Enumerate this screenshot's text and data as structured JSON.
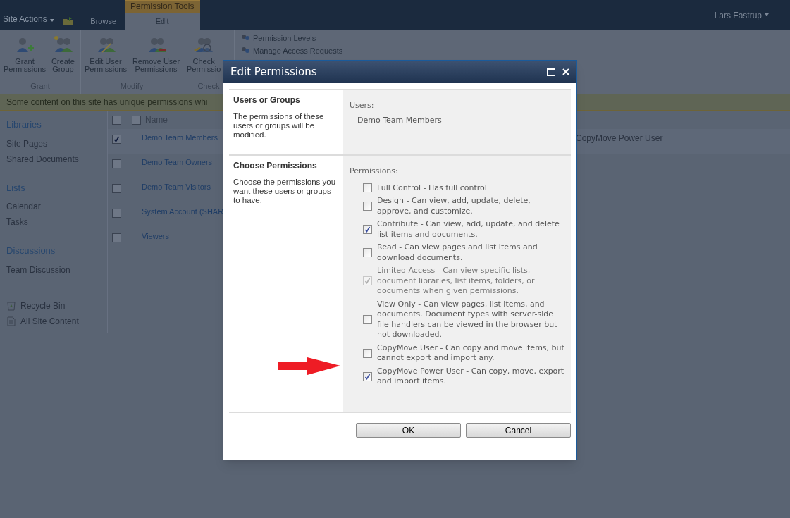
{
  "top_bar": {
    "site_actions": "Site Actions",
    "contextual_group": "Permission Tools",
    "tabs": [
      {
        "label": "Browse",
        "selected": false
      },
      {
        "label": "Edit",
        "selected": true
      }
    ],
    "user": "Lars Fastrup"
  },
  "ribbon": {
    "groups": [
      {
        "label": "Grant",
        "buttons": [
          {
            "kind": "grant",
            "lines": [
              "Grant",
              "Permissions"
            ]
          },
          {
            "kind": "create",
            "lines": [
              "Create",
              "Group"
            ]
          }
        ]
      },
      {
        "label": "Modify",
        "buttons": [
          {
            "kind": "edit",
            "lines": [
              "Edit User",
              "Permissions"
            ]
          },
          {
            "kind": "remove",
            "lines": [
              "Remove User",
              "Permissions"
            ]
          }
        ]
      },
      {
        "label": "Check",
        "buttons": [
          {
            "kind": "check",
            "lines": [
              "Check",
              "Permissio"
            ]
          }
        ]
      }
    ],
    "links": [
      "Permission Levels",
      "Manage Access Requests"
    ]
  },
  "notice": "Some content on this site has unique permissions whi",
  "sidebar": {
    "sections": [
      {
        "heading": "Libraries",
        "items": [
          "Site Pages",
          "Shared Documents"
        ]
      },
      {
        "heading": "Lists",
        "items": [
          "Calendar",
          "Tasks"
        ]
      },
      {
        "heading": "Discussions",
        "items": [
          "Team Discussion"
        ]
      }
    ],
    "footer_links": [
      {
        "kind": "recycle",
        "label": "Recycle Bin"
      },
      {
        "kind": "content",
        "label": "All Site Content"
      }
    ]
  },
  "table": {
    "select_all": {
      "checked": false
    },
    "columns": [
      {
        "label": "Name",
        "checked": false
      }
    ],
    "rows": [
      {
        "name": "Demo Team Members",
        "checked": true,
        "column_3": "CopyMove Power User"
      },
      {
        "name": "Demo Team Owners",
        "checked": false
      },
      {
        "name": "Demo Team Visitors",
        "checked": false
      },
      {
        "name": "System Account (SHAR",
        "checked": false
      },
      {
        "name": "Viewers",
        "checked": false
      }
    ]
  },
  "dialog": {
    "title": "Edit Permissions",
    "users_section": {
      "heading": "Users or Groups",
      "description": "The permissions of these users or groups will be modified.",
      "label": "Users:",
      "value": "Demo Team Members"
    },
    "permissions_section": {
      "heading": "Choose Permissions",
      "description": "Choose the permissions you want these users or groups to have.",
      "label": "Permissions:",
      "options": [
        {
          "label": "Full Control - Has full control.",
          "checked": false,
          "disabled": false
        },
        {
          "label": "Design - Can view, add, update, delete, approve, and customize.",
          "checked": false,
          "disabled": false
        },
        {
          "label": "Contribute - Can view, add, update, and delete list items and documents.",
          "checked": true,
          "disabled": false
        },
        {
          "label": "Read - Can view pages and list items and download documents.",
          "checked": false,
          "disabled": false
        },
        {
          "label": "Limited Access - Can view specific lists, document libraries, list items, folders, or documents when given permissions.",
          "checked": true,
          "disabled": true
        },
        {
          "label": "View Only - Can view pages, list items, and documents. Document types with server-side file handlers can be viewed in the browser but not downloaded.",
          "checked": false,
          "disabled": false
        },
        {
          "label": "CopyMove User - Can copy and move items, but cannot export and import any.",
          "checked": false,
          "disabled": false
        },
        {
          "label": "CopyMove Power User - Can copy, move, export and import items.",
          "checked": true,
          "disabled": false
        }
      ]
    },
    "buttons": [
      "OK",
      "Cancel"
    ]
  }
}
